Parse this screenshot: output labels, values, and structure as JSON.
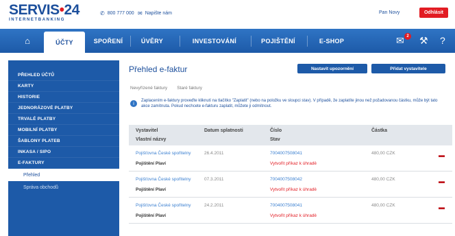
{
  "header": {
    "logo_main": "SERVIS",
    "logo_dot": "•",
    "logo_num": "24",
    "logo_sub": "INTERNETBANKING",
    "phone": "800 777 000",
    "help": "Napište nám",
    "user_link": "Pan Novy",
    "logout": "Odhlásit"
  },
  "nav": {
    "items": [
      "ÚČTY",
      "SPOŘENÍ",
      "ÚVĚRY",
      "INVESTOVÁNÍ",
      "POJIŠTĚNÍ",
      "E-SHOP"
    ],
    "badge": "2"
  },
  "sidebar": {
    "items": [
      "PŘEHLED ÚČTŮ",
      "KARTY",
      "HISTORIE",
      "JEDNORÁZOVÉ PLATBY",
      "TRVALÉ PLATBY",
      "MOBILNÍ PLATBY",
      "ŠABLONY PLATEB",
      "INKASA / SIPO",
      "E-FAKTURY"
    ],
    "sub_items": [
      "Přehled",
      "Správa obchodů"
    ]
  },
  "main": {
    "title": "Přehled e-faktur",
    "btn_settings": "Nastavit upozornění",
    "btn_pair": "Přidat vystavitele",
    "tabs": [
      "Nevyřízené faktury",
      "Staré faktury"
    ],
    "info": "Zaplacením e-faktury proveďte kliknutí na tlačítko \"Zaplatit\" (nebo na položku ve sloupci stav). V případě, že zaplatíte jinou než požadovanou částku, může být tato akce zamítnuta. Pokud nechcete e-fakturu zaplatit, můžete ji odmítnout."
  },
  "table": {
    "headers": {
      "col1_top": "Vystavitel",
      "col1_bottom": "Vlastní názvy",
      "col2": "Datum splatnosti",
      "col3_top": "Číslo",
      "col3_bottom": "Stav",
      "col4": "Částka"
    },
    "rows": [
      {
        "issuer": "Pojišťovna České spořitelny",
        "date": "26.4.2011",
        "number": "7004007508041",
        "amount": "480,00 CZK",
        "label": "Pojištění Plaví",
        "status": "Vytvořit příkaz k úhradě"
      },
      {
        "issuer": "Pojišťovna České spořitelny",
        "date": "07.3.2011",
        "number": "7004007508042",
        "amount": "480,00 CZK",
        "label": "Pojištění Plaví",
        "status": "Vytvořit příkaz k úhradě"
      },
      {
        "issuer": "Pojišťovna České spořitelny",
        "date": "24.2.2011",
        "number": "7004007508041",
        "amount": "480,00 CZK",
        "label": "Pojištění Plaví",
        "status": "Vytvořit příkaz k úhradě"
      }
    ]
  }
}
